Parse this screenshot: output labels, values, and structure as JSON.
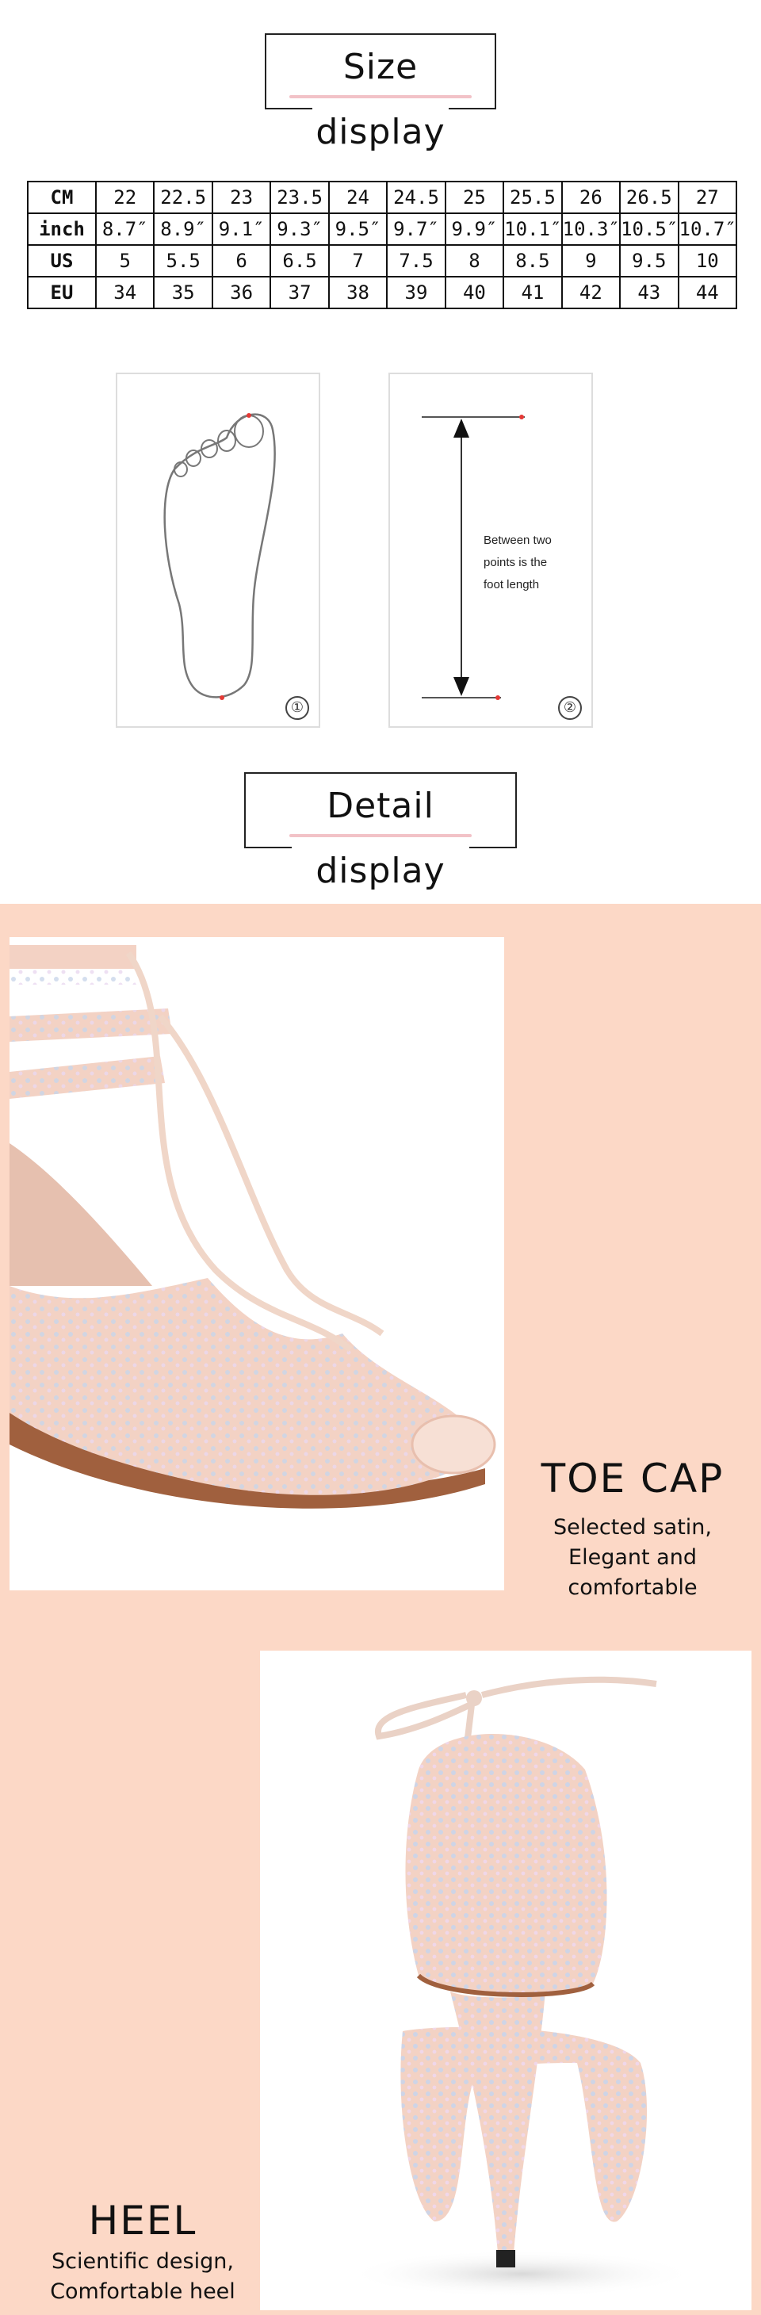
{
  "size_display": {
    "title": "Size display",
    "table": {
      "rows": [
        {
          "label": "CM",
          "values": [
            "22",
            "22.5",
            "23",
            "23.5",
            "24",
            "24.5",
            "25",
            "25.5",
            "26",
            "26.5",
            "27"
          ]
        },
        {
          "label": "inch",
          "values": [
            "8.7″",
            "8.9″",
            "9.1″",
            "9.3″",
            "9.5″",
            "9.7″",
            "9.9″",
            "10.1″",
            "10.3″",
            "10.5″",
            "10.7″"
          ]
        },
        {
          "label": "US",
          "values": [
            "5",
            "5.5",
            "6",
            "6.5",
            "7",
            "7.5",
            "8",
            "8.5",
            "9",
            "9.5",
            "10"
          ]
        },
        {
          "label": "EU",
          "values": [
            "34",
            "35",
            "36",
            "37",
            "38",
            "39",
            "40",
            "41",
            "42",
            "43",
            "44"
          ]
        }
      ]
    },
    "diagram1": {
      "number": "①"
    },
    "diagram2": {
      "number": "②",
      "text_line1": "Between two",
      "text_line2": "points is the",
      "text_line3": "foot length"
    }
  },
  "detail_display": {
    "title": "Detail display",
    "toe_cap": {
      "title": "TOE CAP",
      "line1": "Selected satin,",
      "line2": "Elegant and comfortable"
    },
    "heel": {
      "title": "HEEL",
      "line1": "Scientific design,",
      "line2": "Comfortable heel"
    }
  },
  "colors": {
    "peach_background": "#fcd8c6",
    "title_underline": "#f2c2c7",
    "satin": "#f3d2c4",
    "red_marker": "#e53935"
  }
}
